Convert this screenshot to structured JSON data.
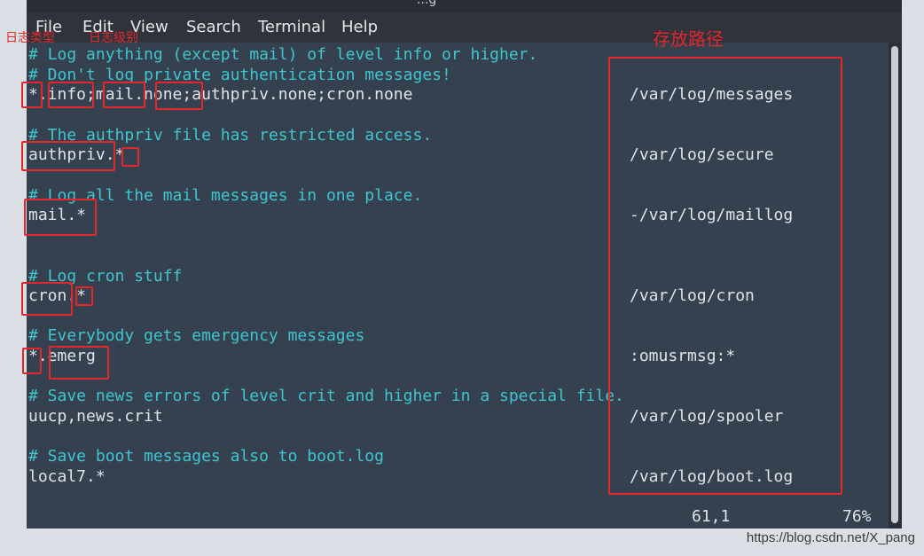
{
  "window": {
    "title": "...g"
  },
  "menu": [
    "File",
    "Edit",
    "View",
    "Search",
    "Terminal",
    "Help"
  ],
  "annotations": {
    "log_type": "日志类型",
    "log_level": "日志级别",
    "storage_path": "存放路径"
  },
  "lines": [
    {
      "kind": "comment",
      "text": "# Log anything (except mail) of level info or higher."
    },
    {
      "kind": "comment",
      "text": "# Don't log private authentication messages!"
    },
    {
      "kind": "rule",
      "text": "*.info;mail.none;authpriv.none;cron.none",
      "path": "/var/log/messages"
    },
    {
      "kind": "comment",
      "text": "# The authpriv file has restricted access."
    },
    {
      "kind": "rule",
      "text": "authpriv.*",
      "path": "/var/log/secure"
    },
    {
      "kind": "comment",
      "text": "# Log all the mail messages in one place."
    },
    {
      "kind": "rule",
      "text": "mail.*",
      "path": "-/var/log/maillog"
    },
    {
      "kind": "comment",
      "text": "# Log cron stuff"
    },
    {
      "kind": "rule",
      "text": "cron.*",
      "path": "/var/log/cron"
    },
    {
      "kind": "comment",
      "text": "# Everybody gets emergency messages"
    },
    {
      "kind": "rule",
      "text": "*.emerg",
      "path": ":omusrmsg:*"
    },
    {
      "kind": "comment",
      "text": "# Save news errors of level crit and higher in a special file."
    },
    {
      "kind": "rule",
      "text": "uucp,news.crit",
      "path": "/var/log/spooler"
    },
    {
      "kind": "comment",
      "text": "# Save boot messages also to boot.log"
    },
    {
      "kind": "rule",
      "text": "local7.*",
      "path": "/var/log/boot.log"
    }
  ],
  "status": {
    "position": "61,1",
    "percent": "76%"
  },
  "watermark": "https://blog.csdn.net/X_pang",
  "colors": {
    "comment": "#3ec5cf",
    "text": "#dfe3e8",
    "annotation": "#e3272a",
    "background": "#36414f"
  }
}
